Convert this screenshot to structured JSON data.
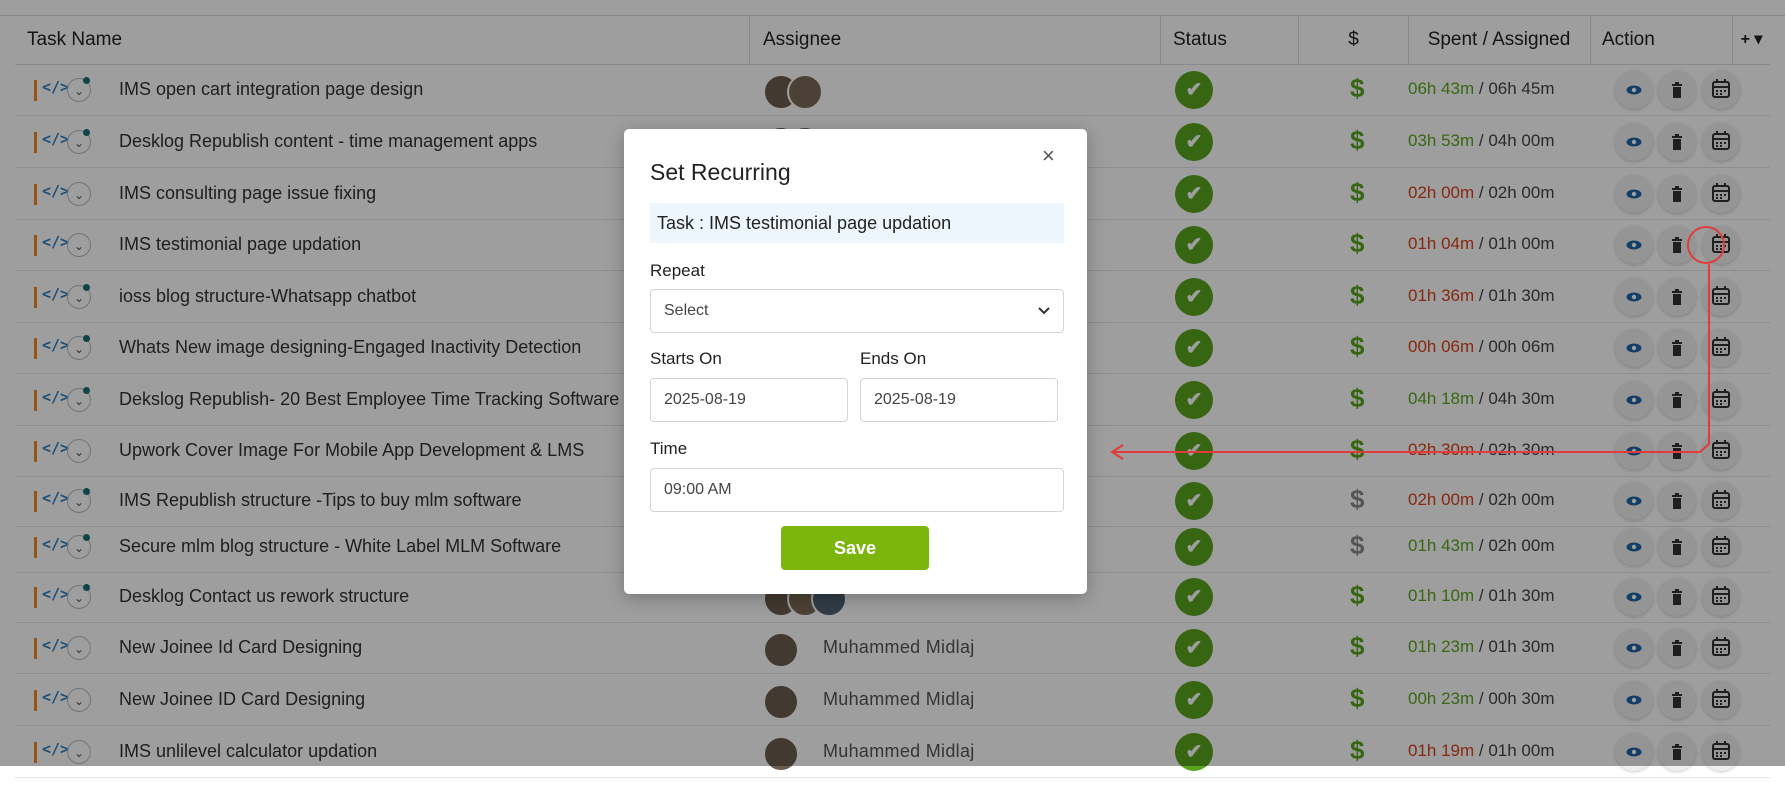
{
  "table": {
    "headers": {
      "task_name": "Task Name",
      "assignee": "Assignee",
      "status": "Status",
      "billable": "$",
      "spent_assigned": "Spent / Assigned",
      "action": "Action",
      "add_column": "+ ▾"
    },
    "rows": [
      {
        "name": "IMS open cart integration page design",
        "assignee_name": "",
        "avatar_count": 2,
        "spent": "06h 43m",
        "spent_color": "green",
        "assigned": "06h 45m",
        "billable": true,
        "has_dot": true
      },
      {
        "name": "Desklog Republish content - time management apps",
        "assignee_name": "",
        "avatar_count": 2,
        "spent": "03h 53m",
        "spent_color": "green",
        "assigned": "04h 00m",
        "billable": true,
        "has_dot": true
      },
      {
        "name": "IMS consulting page issue fixing",
        "assignee_name": "",
        "avatar_count": 0,
        "spent": "02h 00m",
        "spent_color": "red",
        "assigned": "02h 00m",
        "billable": true,
        "has_dot": false
      },
      {
        "name": "IMS testimonial page updation",
        "assignee_name": "",
        "avatar_count": 0,
        "spent": "01h 04m",
        "spent_color": "red",
        "assigned": "01h 00m",
        "billable": true,
        "has_dot": false
      },
      {
        "name": "ioss blog structure-Whatsapp chatbot",
        "assignee_name": "",
        "avatar_count": 0,
        "spent": "01h 36m",
        "spent_color": "red",
        "assigned": "01h 30m",
        "billable": true,
        "has_dot": true
      },
      {
        "name": "Whats New image designing-Engaged Inactivity Detection",
        "assignee_name": "",
        "avatar_count": 0,
        "spent": "00h 06m",
        "spent_color": "red",
        "assigned": "00h 06m",
        "billable": true,
        "has_dot": true
      },
      {
        "name": "Dekslog Republish- 20 Best Employee Time Tracking Software",
        "assignee_name": "",
        "avatar_count": 0,
        "spent": "04h 18m",
        "spent_color": "green",
        "assigned": "04h 30m",
        "billable": true,
        "has_dot": true
      },
      {
        "name": "Upwork Cover Image For Mobile App Development & LMS",
        "assignee_name": "",
        "avatar_count": 0,
        "spent": "02h 30m",
        "spent_color": "red",
        "assigned": "02h 30m",
        "billable": true,
        "has_dot": false
      },
      {
        "name": "IMS Republish structure -Tips to buy mlm software",
        "assignee_name": "",
        "avatar_count": 0,
        "spent": "02h 00m",
        "spent_color": "red",
        "assigned": "02h 00m",
        "billable": false,
        "has_dot": true
      },
      {
        "name": "Secure mlm blog structure - White Label MLM Software",
        "assignee_name": "",
        "avatar_count": 0,
        "spent": "01h 43m",
        "spent_color": "green",
        "assigned": "02h 00m",
        "billable": false,
        "has_dot": true
      },
      {
        "name": "Desklog Contact us rework structure",
        "assignee_name": "",
        "avatar_count": 3,
        "spent": "01h 10m",
        "spent_color": "green",
        "assigned": "01h 30m",
        "billable": true,
        "has_dot": true
      },
      {
        "name": "New Joinee Id Card Designing",
        "assignee_name": "Muhammed Midlaj",
        "avatar_count": 1,
        "spent": "01h 23m",
        "spent_color": "green",
        "assigned": "01h 30m",
        "billable": true,
        "has_dot": false
      },
      {
        "name": "New Joinee ID Card Designing",
        "assignee_name": "Muhammed Midlaj",
        "avatar_count": 1,
        "spent": "00h 23m",
        "spent_color": "green",
        "assigned": "00h 30m",
        "billable": true,
        "has_dot": false
      },
      {
        "name": "IMS unlilevel calculator updation",
        "assignee_name": "Muhammed Midlaj",
        "avatar_count": 1,
        "spent": "01h 19m",
        "spent_color": "red",
        "assigned": "01h 00m",
        "billable": true,
        "has_dot": false
      }
    ],
    "code_glyph": "</>",
    "status_glyph": "✔",
    "dollar_glyph": "$",
    "separator": " / ",
    "icons": {
      "eye": "eye-icon",
      "trash": "trash-icon",
      "calendar": "recurring-calendar-icon",
      "chevron": "chevron-down-icon",
      "code": "code-icon"
    }
  },
  "colors": {
    "accent_green": "#58a51c",
    "spent_green": "#5aa81f",
    "spent_red": "#d8431b",
    "eye_blue": "#1e64a8",
    "annotation_red": "#e23b3b",
    "save_green": "#7cb50d"
  },
  "modal": {
    "title": "Set Recurring",
    "close": "×",
    "task_label": "Task : IMS testimonial page updation",
    "repeat_label": "Repeat",
    "repeat_value": "Select",
    "starts_label": "Starts On",
    "starts_value": "2025-08-19",
    "ends_label": "Ends On",
    "ends_value": "2025-08-19",
    "time_label": "Time",
    "time_value": "09:00 AM",
    "save_label": "Save"
  }
}
